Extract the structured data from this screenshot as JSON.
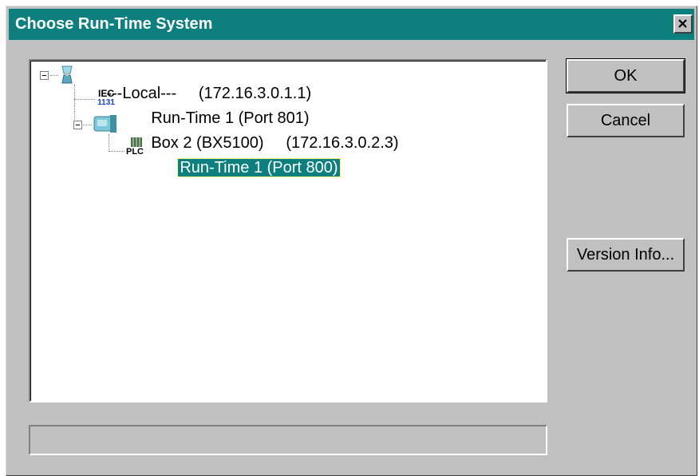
{
  "window": {
    "title": "Choose Run-Time System",
    "close_icon": "close-icon",
    "colors": {
      "titlebar": "#0e7f7f",
      "face": "#c0c0c0",
      "selection": "#0e7f7f"
    }
  },
  "tree": {
    "nodes": [
      {
        "label": "---Local---     (172.16.3.0.1.1)",
        "icon": "local-computer-icon",
        "expanded": true
      },
      {
        "label": "Run-Time 1 (Port 801)",
        "icon": "iec1131-icon",
        "icon_text_top": "IEC",
        "icon_text_bottom": "1131"
      },
      {
        "label": "Box 2 (BX5100)     (172.16.3.0.2.3)",
        "icon": "network-box-icon",
        "expanded": true
      },
      {
        "label": "Run-Time 1 (Port 800)",
        "icon": "plc-icon",
        "icon_text": "PLC",
        "selected": true
      }
    ]
  },
  "buttons": {
    "ok": "OK",
    "cancel": "Cancel",
    "version_info": "Version Info..."
  },
  "status": {
    "text": ""
  }
}
